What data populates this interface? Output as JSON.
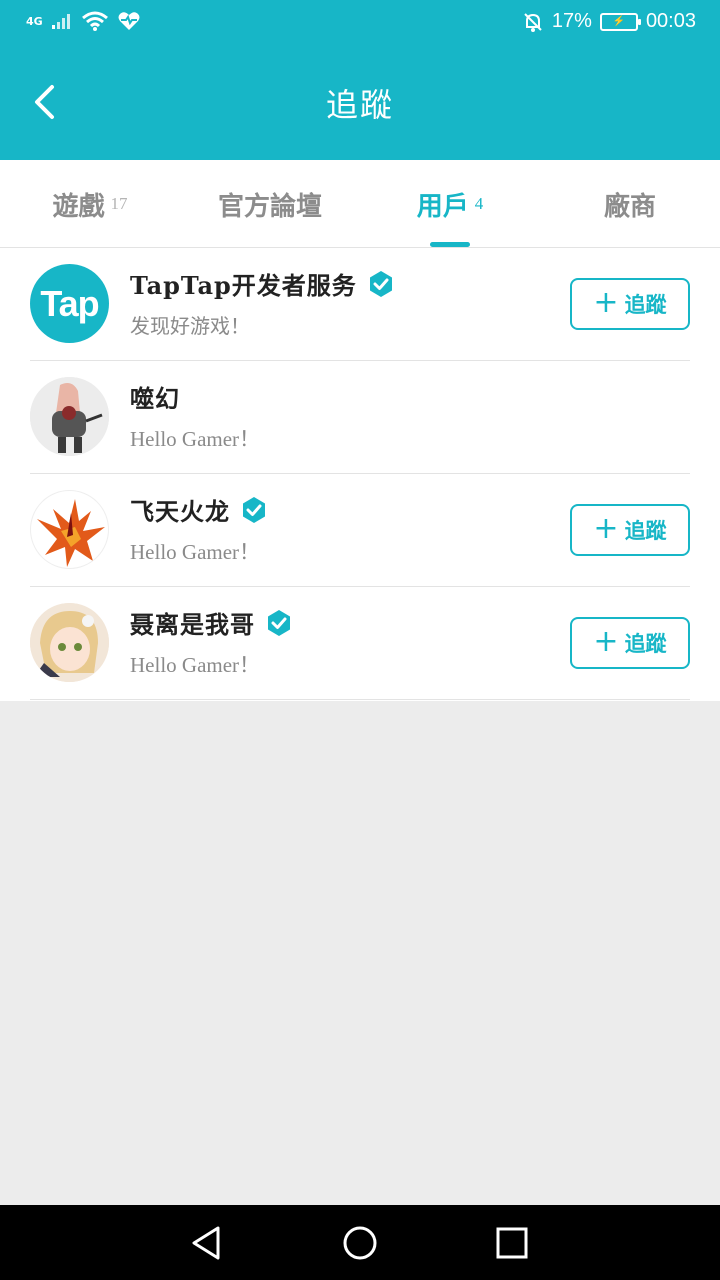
{
  "status_bar": {
    "network": "4G",
    "battery_percent": "17%",
    "time": "00:03",
    "icons": [
      "signal-icon",
      "wifi-icon",
      "heart-rate-icon",
      "mute-bell-icon",
      "battery-charging-icon"
    ]
  },
  "header": {
    "title": "追蹤"
  },
  "tabs": [
    {
      "label": "遊戲",
      "count": "17"
    },
    {
      "label": "官方論壇",
      "count": ""
    },
    {
      "label": "用戶",
      "count": "4",
      "active": true
    },
    {
      "label": "廠商",
      "count": ""
    }
  ],
  "users": [
    {
      "name": "TapTap开发者服务",
      "verified": true,
      "desc": "发现好游戏！",
      "follow_label": "追蹤",
      "avatar_text": "Tap",
      "avatar_color": "#17b6c7"
    },
    {
      "name": "噬幻",
      "verified": false,
      "desc": "Hello Gamer！"
    },
    {
      "name": "飞天火龙",
      "verified": true,
      "desc": "Hello Gamer！",
      "follow_label": "追蹤"
    },
    {
      "name": "聂离是我哥",
      "verified": true,
      "desc": "Hello Gamer！",
      "follow_label": "追蹤"
    }
  ],
  "colors": {
    "accent": "#17b6c7",
    "background": "#ececec"
  }
}
